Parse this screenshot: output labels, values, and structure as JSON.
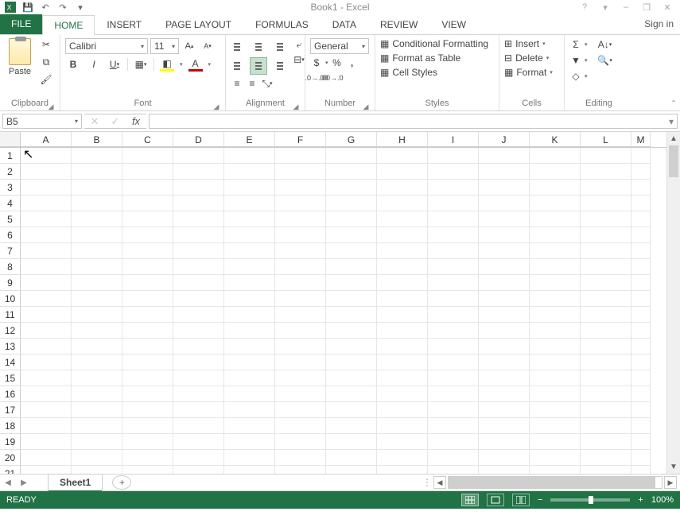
{
  "title": "Book1 - Excel",
  "qat": {
    "save": "💾",
    "undo": "↶",
    "redo": "↷"
  },
  "window": {
    "help": "?",
    "ribbon_opts": "▾",
    "min": "–",
    "restore": "❐",
    "close": "✕"
  },
  "tabs": {
    "file": "FILE",
    "items": [
      "HOME",
      "INSERT",
      "PAGE LAYOUT",
      "FORMULAS",
      "DATA",
      "REVIEW",
      "VIEW"
    ],
    "active": "HOME",
    "signin": "Sign in"
  },
  "ribbon": {
    "clipboard": {
      "label": "Clipboard",
      "paste": "Paste",
      "cut": "✂",
      "copy": "⧉",
      "painter": "🖌"
    },
    "font": {
      "label": "Font",
      "name": "Calibri",
      "size": "11",
      "grow": "A▴",
      "shrink": "A▾",
      "bold": "B",
      "italic": "I",
      "underline": "U",
      "border": "▦",
      "fill": "◧",
      "color": "A"
    },
    "alignment": {
      "label": "Alignment",
      "wrap": "Wrap Text",
      "merge": "Merge & Center",
      "indent_dec": "◀▏",
      "indent_inc": "▕▶",
      "orient": "⤡"
    },
    "number": {
      "label": "Number",
      "format": "General",
      "currency": "$",
      "percent": "%",
      "comma": ",",
      "inc_dec": "⁰⁰",
      "dec_dec": "⁰⁰"
    },
    "styles": {
      "label": "Styles",
      "conditional": "Conditional Formatting",
      "table": "Format as Table",
      "cell": "Cell Styles"
    },
    "cells": {
      "label": "Cells",
      "insert": "Insert",
      "delete": "Delete",
      "format": "Format"
    },
    "editing": {
      "label": "Editing",
      "autosum": "Σ",
      "fill": "▾",
      "clear": "◇",
      "sort": "⇅",
      "find": "🔍"
    }
  },
  "namebox": "B5",
  "fx": {
    "cancel": "✕",
    "enter": "✓",
    "fx": "fx"
  },
  "grid": {
    "columns": [
      "A",
      "B",
      "C",
      "D",
      "E",
      "F",
      "G",
      "H",
      "I",
      "J",
      "K",
      "L",
      "M"
    ],
    "rows": [
      1,
      2,
      3,
      4,
      5,
      6,
      7,
      8,
      9,
      10,
      11,
      12,
      13,
      14,
      15,
      16,
      17,
      18,
      19,
      20,
      21
    ]
  },
  "sheets": {
    "active": "Sheet1",
    "add": "+",
    "nav_prev": "◀",
    "nav_next": "▶"
  },
  "status": {
    "ready": "READY",
    "zoom": "100%",
    "minus": "−",
    "plus": "+"
  }
}
